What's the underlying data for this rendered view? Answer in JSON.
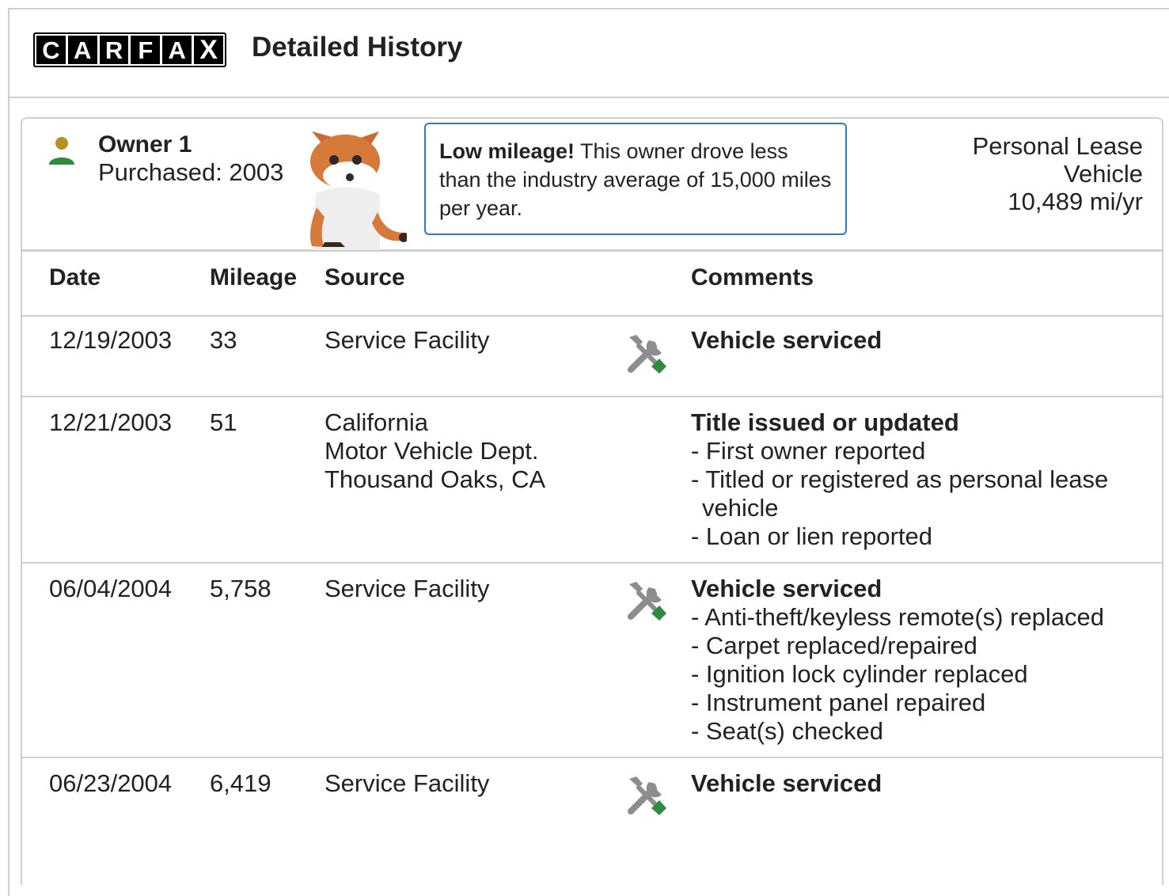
{
  "brand": {
    "logo_letters": [
      "C",
      "A",
      "R",
      "F",
      "A",
      "X"
    ]
  },
  "header": {
    "title": "Detailed History"
  },
  "owner": {
    "name": "Owner 1",
    "purchased": "Purchased: 2003",
    "tip_bold": "Low mileage!",
    "tip_text": " This owner drove less than the industry average of 15,000 miles per year.",
    "usage_line1": "Personal Lease",
    "usage_line2": "Vehicle",
    "mileage_rate": "10,489 mi/yr"
  },
  "table": {
    "headers": {
      "date": "Date",
      "mileage": "Mileage",
      "source": "Source",
      "comments": "Comments"
    },
    "rows": [
      {
        "date": "12/19/2003",
        "mileage": "33",
        "source": [
          "Service Facility"
        ],
        "icon": "service-tools-icon",
        "comment_title": "Vehicle serviced",
        "details": []
      },
      {
        "date": "12/21/2003",
        "mileage": "51",
        "source": [
          "California",
          "Motor Vehicle Dept.",
          "Thousand Oaks, CA"
        ],
        "icon": "",
        "comment_title": "Title issued or updated",
        "details": [
          "- First owner reported",
          "- Titled or registered as personal lease vehicle",
          "- Loan or lien reported"
        ]
      },
      {
        "date": "06/04/2004",
        "mileage": "5,758",
        "source": [
          "Service Facility"
        ],
        "icon": "service-tools-icon",
        "comment_title": "Vehicle serviced",
        "details": [
          "- Anti-theft/keyless remote(s) replaced",
          "- Carpet replaced/repaired",
          "- Ignition lock cylinder replaced",
          "- Instrument panel repaired",
          "- Seat(s) checked"
        ]
      },
      {
        "date": "06/23/2004",
        "mileage": "6,419",
        "source": [
          "Service Facility"
        ],
        "icon": "service-tools-icon",
        "comment_title": "Vehicle serviced",
        "details": []
      }
    ]
  },
  "colors": {
    "accent_blue": "#3777bc",
    "person_head": "#b8901f",
    "person_body": "#2e8b3f",
    "tool_gray": "#8d8d8d",
    "tool_green": "#2e8b3f",
    "divider": "#cfcfcf"
  }
}
